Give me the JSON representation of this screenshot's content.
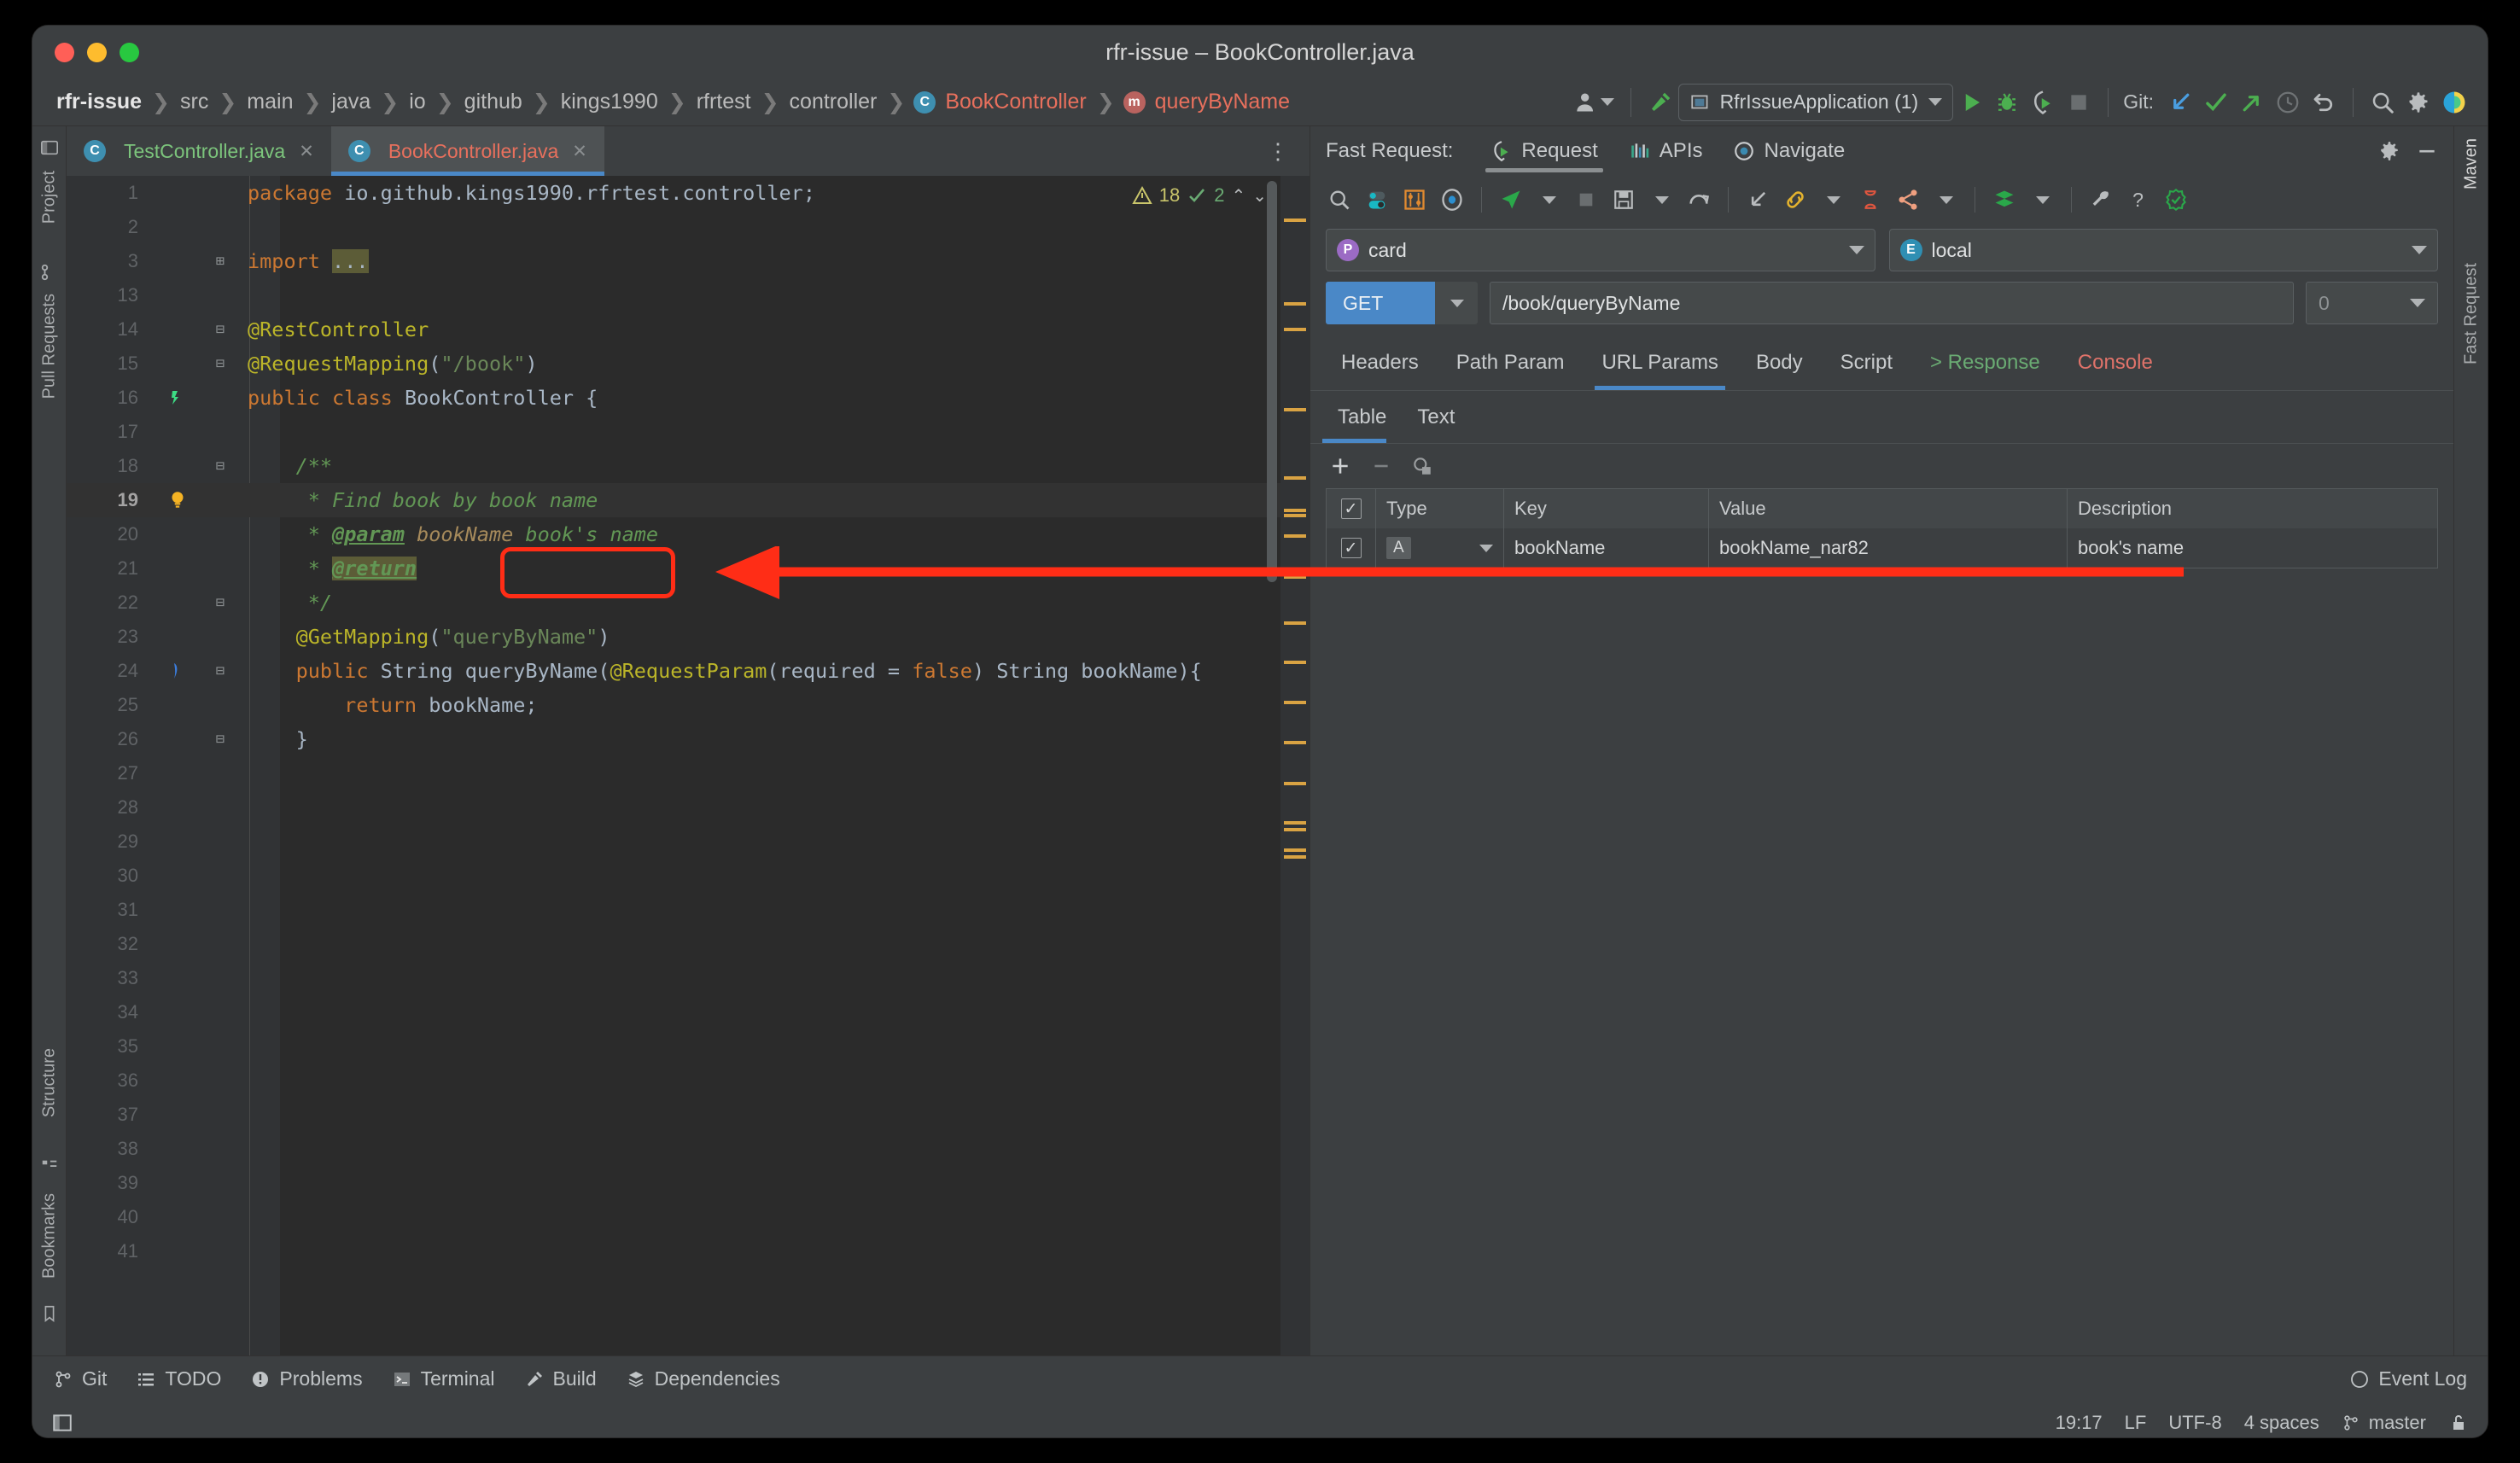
{
  "window": {
    "title": "rfr-issue – BookController.java"
  },
  "breadcrumb": {
    "items": [
      {
        "label": "rfr-issue",
        "kind": "project"
      },
      {
        "label": "src",
        "kind": "dir"
      },
      {
        "label": "main",
        "kind": "dir"
      },
      {
        "label": "java",
        "kind": "dir"
      },
      {
        "label": "io",
        "kind": "dir"
      },
      {
        "label": "github",
        "kind": "dir"
      },
      {
        "label": "kings1990",
        "kind": "dir"
      },
      {
        "label": "rfrtest",
        "kind": "dir"
      },
      {
        "label": "controller",
        "kind": "dir"
      },
      {
        "label": "BookController",
        "kind": "class",
        "icon": "C"
      },
      {
        "label": "queryByName",
        "kind": "method",
        "icon": "m"
      }
    ]
  },
  "toolbar": {
    "run_config": "RfrIssueApplication (1)",
    "git_label": "Git:",
    "icons": {
      "account": "account-icon",
      "build": "build-hammer-icon",
      "run": "run-icon",
      "debug": "debug-icon",
      "run_coverage": "run-with-coverage-icon",
      "stop": "stop-icon",
      "git_update": "git-update-icon",
      "git_commit": "git-commit-icon",
      "git_push": "git-push-icon",
      "git_history": "git-history-icon",
      "git_rollback": "git-rollback-icon",
      "search": "search-everywhere-icon",
      "settings": "settings-gear-icon",
      "ai": "ai-assistant-icon"
    }
  },
  "left_strip": {
    "items": [
      "Project",
      "Pull Requests",
      "Structure",
      "Bookmarks"
    ]
  },
  "right_strip": {
    "items": [
      "Maven",
      "Fast Request"
    ]
  },
  "editor": {
    "tabs": [
      {
        "label": "TestController.java",
        "icon": "C",
        "active": false
      },
      {
        "label": "BookController.java",
        "icon": "C",
        "active": true
      }
    ],
    "inspection": {
      "warnings": "18",
      "checks": "2"
    },
    "lines": [
      {
        "num": "1",
        "tokens": [
          {
            "t": "package ",
            "c": "kw"
          },
          {
            "t": "io.github.kings1990.rfrtest.controller;",
            "c": "plain"
          }
        ]
      },
      {
        "num": "2",
        "tokens": []
      },
      {
        "num": "3",
        "fold": "+",
        "tokens": [
          {
            "t": "import ",
            "c": "kw"
          },
          {
            "t": "...",
            "c": "folded"
          }
        ]
      },
      {
        "num": "13",
        "tokens": []
      },
      {
        "num": "14",
        "fold": "-",
        "tokens": [
          {
            "t": "@RestController",
            "c": "ann"
          }
        ]
      },
      {
        "num": "15",
        "fold": "-",
        "tokens": [
          {
            "t": "@RequestMapping",
            "c": "ann"
          },
          {
            "t": "(",
            "c": "plain"
          },
          {
            "t": "\"/book\"",
            "c": "str"
          },
          {
            "t": ")",
            "c": "plain"
          }
        ]
      },
      {
        "num": "16",
        "gutter_icon": "class-marker-icon",
        "tokens": [
          {
            "t": "public class ",
            "c": "kw"
          },
          {
            "t": "BookController ",
            "c": "plain"
          },
          {
            "t": "{",
            "c": "plain"
          }
        ]
      },
      {
        "num": "17",
        "tokens": []
      },
      {
        "num": "18",
        "fold": "-",
        "tokens": [
          {
            "t": "    /**",
            "c": "cmt"
          }
        ]
      },
      {
        "num": "19",
        "gutter_icon": "intention-bulb-icon",
        "current": true,
        "tokens": [
          {
            "t": "     * Find book by book name",
            "c": "cmt"
          }
        ]
      },
      {
        "num": "20",
        "tokens": [
          {
            "t": "     * ",
            "c": "cmt"
          },
          {
            "t": "@param",
            "c": "cmt-tag"
          },
          {
            "t": " bookName",
            "c": "param"
          },
          {
            "t": " book's name",
            "c": "cmt"
          }
        ]
      },
      {
        "num": "21",
        "tokens": [
          {
            "t": "     * ",
            "c": "cmt"
          },
          {
            "t": "@return",
            "c": "cmt-tag-hl"
          }
        ]
      },
      {
        "num": "22",
        "fold": "-",
        "tokens": [
          {
            "t": "     */",
            "c": "cmt"
          }
        ]
      },
      {
        "num": "23",
        "tokens": [
          {
            "t": "    @GetMapping",
            "c": "ann"
          },
          {
            "t": "(",
            "c": "plain"
          },
          {
            "t": "\"queryByName\"",
            "c": "str"
          },
          {
            "t": ")",
            "c": "plain"
          }
        ]
      },
      {
        "num": "24",
        "gutter_icon": "web-mapping-icon",
        "fold": "-",
        "tokens": [
          {
            "t": "    public ",
            "c": "kw"
          },
          {
            "t": "String ",
            "c": "plain"
          },
          {
            "t": "queryByName",
            "c": "plain"
          },
          {
            "t": "(",
            "c": "plain"
          },
          {
            "t": "@RequestParam",
            "c": "ann"
          },
          {
            "t": "(required = ",
            "c": "plain"
          },
          {
            "t": "false",
            "c": "kw"
          },
          {
            "t": ") String bookName){",
            "c": "plain"
          }
        ]
      },
      {
        "num": "25",
        "tokens": [
          {
            "t": "        return ",
            "c": "kw"
          },
          {
            "t": "bookName;",
            "c": "plain"
          }
        ]
      },
      {
        "num": "26",
        "fold": "-",
        "tokens": [
          {
            "t": "    }",
            "c": "plain"
          }
        ]
      },
      {
        "num": "27",
        "tokens": []
      },
      {
        "num": "28",
        "tokens": []
      },
      {
        "num": "29",
        "tokens": []
      },
      {
        "num": "30",
        "tokens": []
      },
      {
        "num": "31",
        "tokens": []
      },
      {
        "num": "32",
        "tokens": []
      },
      {
        "num": "33",
        "tokens": []
      },
      {
        "num": "34",
        "tokens": []
      },
      {
        "num": "35",
        "tokens": []
      },
      {
        "num": "36",
        "tokens": []
      },
      {
        "num": "37",
        "tokens": []
      },
      {
        "num": "38",
        "tokens": []
      },
      {
        "num": "39",
        "tokens": []
      },
      {
        "num": "40",
        "tokens": []
      },
      {
        "num": "41",
        "tokens": []
      }
    ]
  },
  "fast_request": {
    "title": "Fast Request:",
    "tabs": [
      {
        "label": "Request",
        "icon": "request-icon",
        "active": true
      },
      {
        "label": "APIs",
        "icon": "apis-icon",
        "active": false
      },
      {
        "label": "Navigate",
        "icon": "navigate-icon",
        "active": false
      }
    ],
    "toolbar_icons": [
      "search-icon",
      "toggle-icon",
      "filter-settings-icon",
      "record-icon",
      "send-icon",
      "send-dropdown-icon",
      "stop-icon",
      "save-icon",
      "save-dropdown-icon",
      "redo-icon",
      "collapse-icon",
      "link-icon",
      "link-dropdown-icon",
      "timer-icon",
      "share-icon",
      "share-dropdown-icon",
      "stack-icon",
      "stack-dropdown-icon",
      "wrench-icon",
      "help-icon",
      "check-badge-icon"
    ],
    "header_actions": [
      "settings-gear-icon",
      "minimize-icon"
    ],
    "project_select": {
      "value": "card",
      "badge": "P"
    },
    "env_select": {
      "value": "local",
      "badge": "E"
    },
    "method": "GET",
    "url": "/book/queryByName",
    "timeout": "0",
    "tabs2": [
      {
        "label": "Headers",
        "active": false
      },
      {
        "label": "Path Param",
        "active": false
      },
      {
        "label": "URL Params",
        "active": true
      },
      {
        "label": "Body",
        "active": false
      },
      {
        "label": "Script",
        "active": false
      },
      {
        "label": "> Response",
        "active": false,
        "style": "response"
      },
      {
        "label": "Console",
        "active": false,
        "style": "console"
      }
    ],
    "tabs3": [
      {
        "label": "Table",
        "active": true
      },
      {
        "label": "Text",
        "active": false
      }
    ],
    "table_tools": [
      "add-row-icon",
      "remove-row-icon",
      "bulk-edit-icon"
    ],
    "table": {
      "columns": [
        "",
        "Type",
        "Key",
        "Value",
        "Description"
      ],
      "rows": [
        {
          "checked": true,
          "type": "A",
          "key": "bookName",
          "value": "bookName_nar82",
          "description": "book's name"
        }
      ]
    }
  },
  "bottom_bar": {
    "items": [
      {
        "label": "Git",
        "icon": "git-branch-icon"
      },
      {
        "label": "TODO",
        "icon": "todo-list-icon"
      },
      {
        "label": "Problems",
        "icon": "problems-icon"
      },
      {
        "label": "Terminal",
        "icon": "terminal-icon"
      },
      {
        "label": "Build",
        "icon": "build-hammer-icon"
      },
      {
        "label": "Dependencies",
        "icon": "dependencies-icon"
      }
    ],
    "event_log": "Event Log"
  },
  "status_bar": {
    "position": "19:17",
    "line_separator": "LF",
    "encoding": "UTF-8",
    "indent": "4 spaces",
    "branch": "master",
    "lock": "lock-open-icon"
  },
  "annotations": {
    "highlight_label": "book's name",
    "accent_color": "#ff2d16"
  },
  "colors": {
    "accent_blue": "#4a88c7",
    "editor_bg": "#2b2b2b",
    "panel_bg": "#3c3f41",
    "comment_green": "#629755",
    "keyword_orange": "#cc7832",
    "annotation_yellow": "#bbb529",
    "string_green": "#6a8759"
  }
}
